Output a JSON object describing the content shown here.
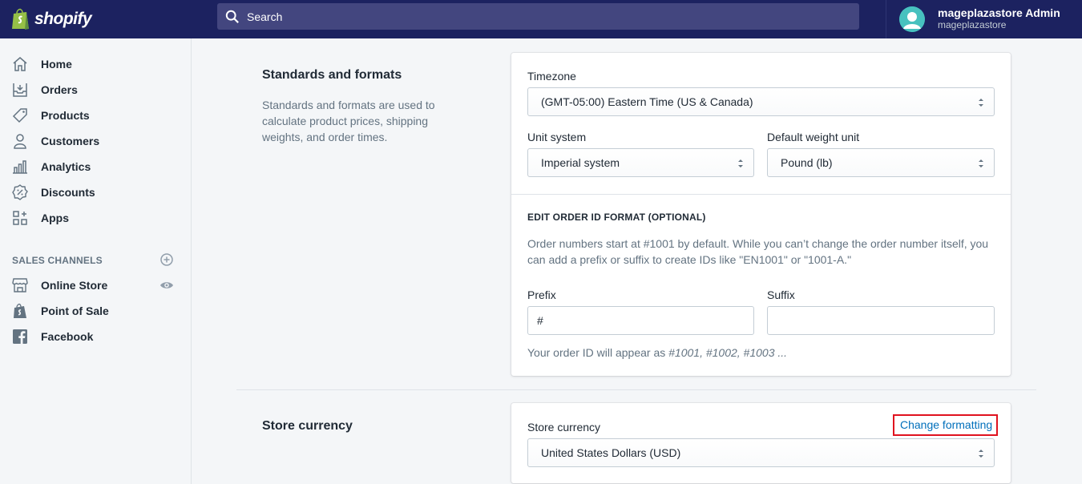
{
  "brand": {
    "name": "shopify"
  },
  "search": {
    "placeholder": "Search"
  },
  "user": {
    "name": "mageplazastore Admin",
    "store": "mageplazastore"
  },
  "sidebar": {
    "items": [
      {
        "label": "Home",
        "icon": "home-icon"
      },
      {
        "label": "Orders",
        "icon": "orders-icon"
      },
      {
        "label": "Products",
        "icon": "tag-icon"
      },
      {
        "label": "Customers",
        "icon": "person-icon"
      },
      {
        "label": "Analytics",
        "icon": "bar-chart-icon"
      },
      {
        "label": "Discounts",
        "icon": "discount-icon"
      },
      {
        "label": "Apps",
        "icon": "apps-icon"
      }
    ],
    "channels_heading": "SALES CHANNELS",
    "channels": [
      {
        "label": "Online Store",
        "icon": "store-icon"
      },
      {
        "label": "Point of Sale",
        "icon": "pos-bag-icon"
      },
      {
        "label": "Facebook",
        "icon": "facebook-icon"
      }
    ]
  },
  "standards": {
    "title": "Standards and formats",
    "description": "Standards and formats are used to calculate product prices, shipping weights, and order times.",
    "timezone_label": "Timezone",
    "timezone_value": "(GMT-05:00) Eastern Time (US & Canada)",
    "unit_label": "Unit system",
    "unit_value": "Imperial system",
    "weight_label": "Default weight unit",
    "weight_value": "Pound (lb)",
    "order_id_heading": "EDIT ORDER ID FORMAT (OPTIONAL)",
    "order_id_help": "Order numbers start at #1001 by default. While you can’t change the order number itself, you can add a prefix or suffix to create IDs like \"EN1001\" or \"1001-A.\"",
    "prefix_label": "Prefix",
    "prefix_value": "#",
    "suffix_label": "Suffix",
    "suffix_value": "",
    "preview_prefix": "Your order ID will appear as ",
    "preview_examples": "#1001, #1002, #1003 ..."
  },
  "currency": {
    "title": "Store currency",
    "field_label": "Store currency",
    "change_link": "Change formatting",
    "value": "United States Dollars (USD)"
  },
  "colors": {
    "topbar": "#1c2260",
    "search": "#43467f",
    "link": "#006fbb",
    "highlight": "#e0131f"
  }
}
